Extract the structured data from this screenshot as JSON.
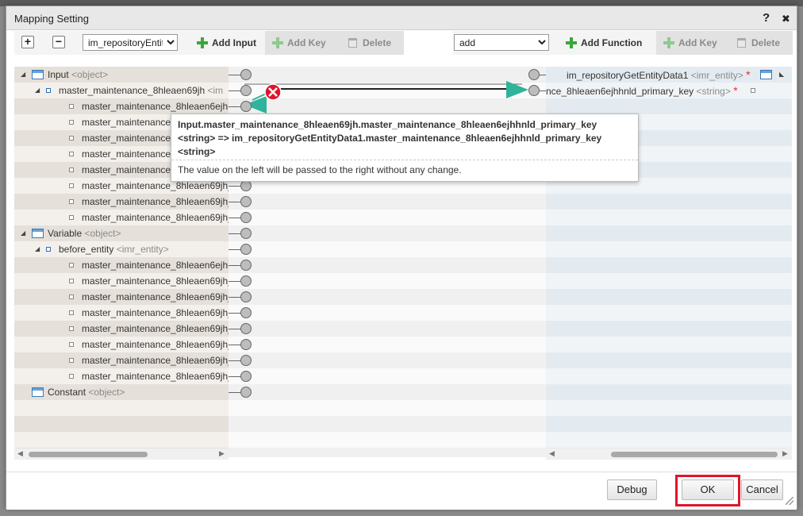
{
  "dialog": {
    "title": "Mapping Setting",
    "help_glyph": "?",
    "close_glyph": "✖"
  },
  "left_toolbar": {
    "expand_glyph": "+",
    "collapse_glyph": "−",
    "select_value": "im_repositoryEntit",
    "add_input_label": "Add Input",
    "add_key_label": "Add Key",
    "delete_label": "Delete"
  },
  "right_toolbar": {
    "select_value": "add",
    "add_function_label": "Add Function",
    "add_key_label": "Add Key",
    "delete_label": "Delete"
  },
  "left_tree": [
    {
      "text": "Input",
      "type": "<object>",
      "level": 0,
      "icon": "object",
      "expander": "◢"
    },
    {
      "text": "master_maintenance_8hleaen69jh",
      "type": "<im",
      "level": 1,
      "icon": "leaf-blue",
      "expander": "◢"
    },
    {
      "text": "master_maintenance_8hleaen6ejhh",
      "type": "",
      "level": 2,
      "icon": "leaf"
    },
    {
      "text": "master_maintenance",
      "type": "",
      "level": 2,
      "icon": "leaf"
    },
    {
      "text": "master_maintenance",
      "type": "",
      "level": 2,
      "icon": "leaf"
    },
    {
      "text": "master_maintenance",
      "type": "",
      "level": 2,
      "icon": "leaf"
    },
    {
      "text": "master_maintenance",
      "type": "",
      "level": 2,
      "icon": "leaf"
    },
    {
      "text": "master_maintenance_8hleaen69jh_",
      "type": "",
      "level": 2,
      "icon": "leaf"
    },
    {
      "text": "master_maintenance_8hleaen69jh_",
      "type": "",
      "level": 2,
      "icon": "leaf"
    },
    {
      "text": "master_maintenance_8hleaen69jh_",
      "type": "",
      "level": 2,
      "icon": "leaf"
    },
    {
      "text": "Variable",
      "type": "<object>",
      "level": 0,
      "icon": "object",
      "expander": "◢"
    },
    {
      "text": "before_entity",
      "type": "<imr_entity>",
      "level": 1,
      "icon": "leaf-blue",
      "expander": "◢"
    },
    {
      "text": "master_maintenance_8hleaen6ejhh",
      "type": "",
      "level": 2,
      "icon": "leaf"
    },
    {
      "text": "master_maintenance_8hleaen69jh_",
      "type": "",
      "level": 2,
      "icon": "leaf"
    },
    {
      "text": "master_maintenance_8hleaen69jh_",
      "type": "",
      "level": 2,
      "icon": "leaf"
    },
    {
      "text": "master_maintenance_8hleaen69jh_",
      "type": "",
      "level": 2,
      "icon": "leaf"
    },
    {
      "text": "master_maintenance_8hleaen69jh_",
      "type": "",
      "level": 2,
      "icon": "leaf"
    },
    {
      "text": "master_maintenance_8hleaen69jh_",
      "type": "",
      "level": 2,
      "icon": "leaf"
    },
    {
      "text": "master_maintenance_8hleaen69jh_",
      "type": "",
      "level": 2,
      "icon": "leaf"
    },
    {
      "text": "master_maintenance_8hleaen69jh_",
      "type": "",
      "level": 2,
      "icon": "leaf"
    },
    {
      "text": "Constant",
      "type": "<object>",
      "level": 0,
      "icon": "object",
      "expander": ""
    }
  ],
  "right_tree": [
    {
      "text": "im_repositoryGetEntityData1",
      "type": "<imr_entity>",
      "required": "*"
    },
    {
      "text": "nce_8hleaen6ejhhnld_primary_key",
      "type": "<string>",
      "required": "*"
    }
  ],
  "tooltip": {
    "line1": "Input.master_maintenance_8hleaen69jh.master_maintenance_8hleaen6ejhhnld_primary_key",
    "line2": "<string> => im_repositoryGetEntityData1.master_maintenance_8hleaen6ejhhnld_primary_key",
    "line3": "<string>",
    "description": "The value on the left will be passed to the right without any change."
  },
  "footer": {
    "debug_label": "Debug",
    "ok_label": "OK",
    "cancel_label": "Cancel"
  },
  "colors": {
    "accent_green": "#2fb39a",
    "delete_red": "#e0142a",
    "highlight_red": "#e0142a"
  }
}
